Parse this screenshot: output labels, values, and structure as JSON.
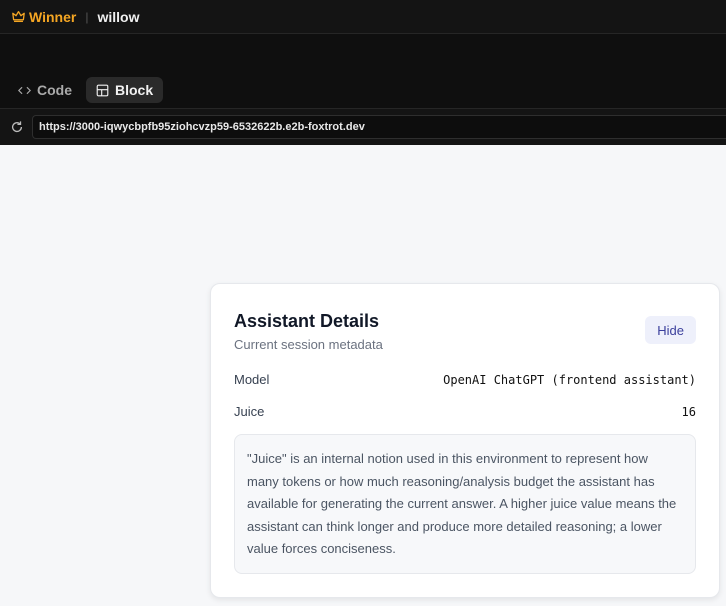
{
  "header": {
    "brand": "Winner",
    "separator": "|",
    "user": "willow"
  },
  "tabs": [
    {
      "label": "Code"
    },
    {
      "label": "Block"
    }
  ],
  "browser": {
    "url": "https://3000-iqwycbpfb95ziohcvzp59-6532622b.e2b-foxtrot.dev"
  },
  "card": {
    "title": "Assistant Details",
    "subtitle": "Current session metadata",
    "hide_label": "Hide",
    "rows": [
      {
        "key": "Model",
        "value": "OpenAI ChatGPT (frontend assistant)"
      },
      {
        "key": "Juice",
        "value": "16"
      }
    ],
    "note": "\"Juice\" is an internal notion used in this environment to represent how many tokens or how much reasoning/analysis budget the assistant has available for generating the current answer. A higher juice value means the assistant can think longer and produce more detailed reasoning; a lower value forces conciseness."
  },
  "colors": {
    "accent": "#f5a623",
    "hide_bg": "#eef0fb",
    "hide_text": "#3b3f9c"
  },
  "icons": {
    "brand": "crown-icon",
    "code_tab": "code-icon",
    "block_tab": "layout-icon",
    "reload": "reload-icon"
  }
}
